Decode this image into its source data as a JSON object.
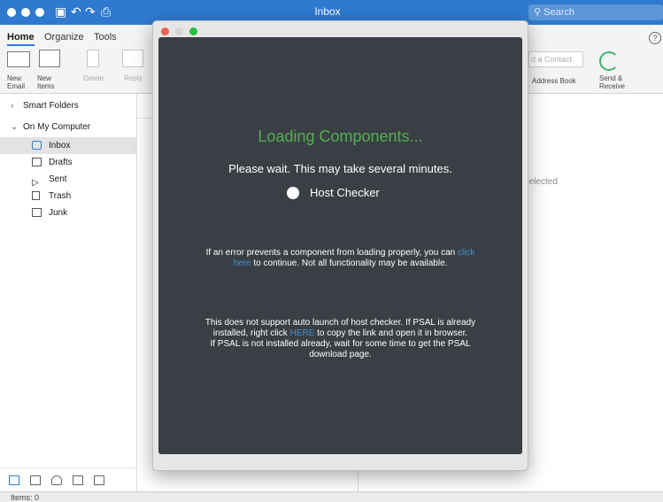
{
  "outlook": {
    "window_title": "Inbox",
    "search_placeholder": "Search",
    "ribbon_tabs": [
      "Home",
      "Organize",
      "Tools"
    ],
    "ribbon_buttons": {
      "new_email": [
        "New",
        "Email"
      ],
      "new_items": [
        "New",
        "Items"
      ],
      "delete": "Delete",
      "reply": "Reply",
      "find_contact": "d a Contact",
      "address_book": "Address Book",
      "send_receive": [
        "Send &",
        "Receive"
      ]
    },
    "sidebar": {
      "smart_folders": "Smart Folders",
      "on_my_computer": "On My Computer",
      "folders": [
        "Inbox",
        "Drafts",
        "Sent",
        "Trash",
        "Junk"
      ]
    },
    "reading_pane_placeholder": "Selected",
    "status": "Items: 0"
  },
  "dialog": {
    "title": "Loading Components...",
    "wait": "Please wait. This may take several minutes.",
    "component": "Host Checker",
    "error_pre": "If an error prevents a component from loading properly, you can",
    "error_link1": "click",
    "error_link2": "here",
    "error_post": "to continue. Not all functionality may be available.",
    "psal_line1": "This does not support auto launch of host checker. If PSAL is already",
    "psal_line2_pre": "installed, right click",
    "psal_link": "HERE",
    "psal_line2_post": "to copy the link and open it in browser.",
    "psal_line3": "If PSAL is not installed already, wait for some time to get the PSAL",
    "psal_line4": "download page."
  },
  "colors": {
    "titlebar": "#2f7ad0",
    "dialog_bg": "#3a3f45",
    "loading_green": "#52b04e",
    "link_blue": "#3f8fd8"
  }
}
